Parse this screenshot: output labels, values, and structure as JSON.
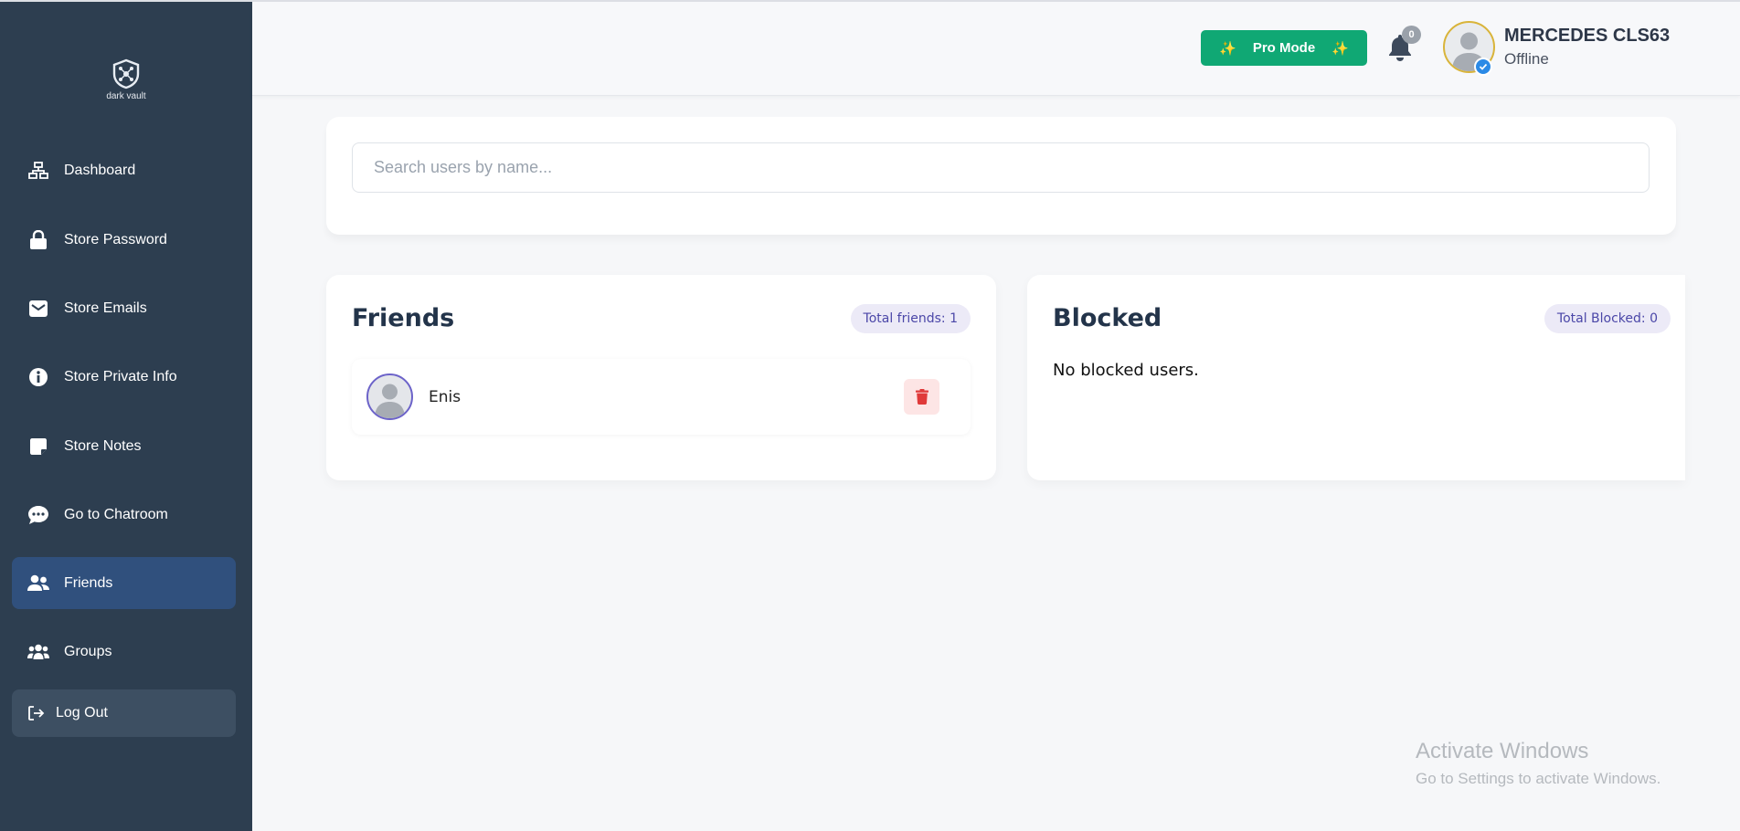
{
  "app": {
    "logo_text": "dark vault"
  },
  "sidebar": {
    "items": [
      {
        "label": "Dashboard",
        "icon": "sitemap-icon"
      },
      {
        "label": "Store Password",
        "icon": "lock-icon"
      },
      {
        "label": "Store Emails",
        "icon": "envelope-icon"
      },
      {
        "label": "Store Private Info",
        "icon": "info-circle-icon"
      },
      {
        "label": "Store Notes",
        "icon": "note-icon"
      },
      {
        "label": "Go to Chatroom",
        "icon": "chat-icon"
      },
      {
        "label": "Friends",
        "icon": "user-friends-icon",
        "active": true
      },
      {
        "label": "Groups",
        "icon": "users-icon"
      }
    ],
    "logout_label": "Log Out"
  },
  "header": {
    "pro_mode_label": "Pro Mode",
    "notification_count": "0",
    "user_name": "MERCEDES CLS63",
    "user_status": "Offline"
  },
  "search": {
    "placeholder": "Search users by name..."
  },
  "friends": {
    "title": "Friends",
    "total_label": "Total friends: 1",
    "list": [
      {
        "name": "Enis"
      }
    ]
  },
  "blocked": {
    "title": "Blocked",
    "total_label": "Total Blocked: 0",
    "empty_message": "No blocked users."
  },
  "watermark": {
    "title": "Activate Windows",
    "subtitle": "Go to Settings to activate Windows."
  },
  "colors": {
    "sidebar_bg": "#2d3e50",
    "sidebar_active": "#30507d",
    "pro_button": "#10a874",
    "delete_bg": "#fde5e5",
    "delete_icon": "#e03a3a",
    "pill_bg": "#eceaf7",
    "pill_text": "#4b47a8"
  }
}
